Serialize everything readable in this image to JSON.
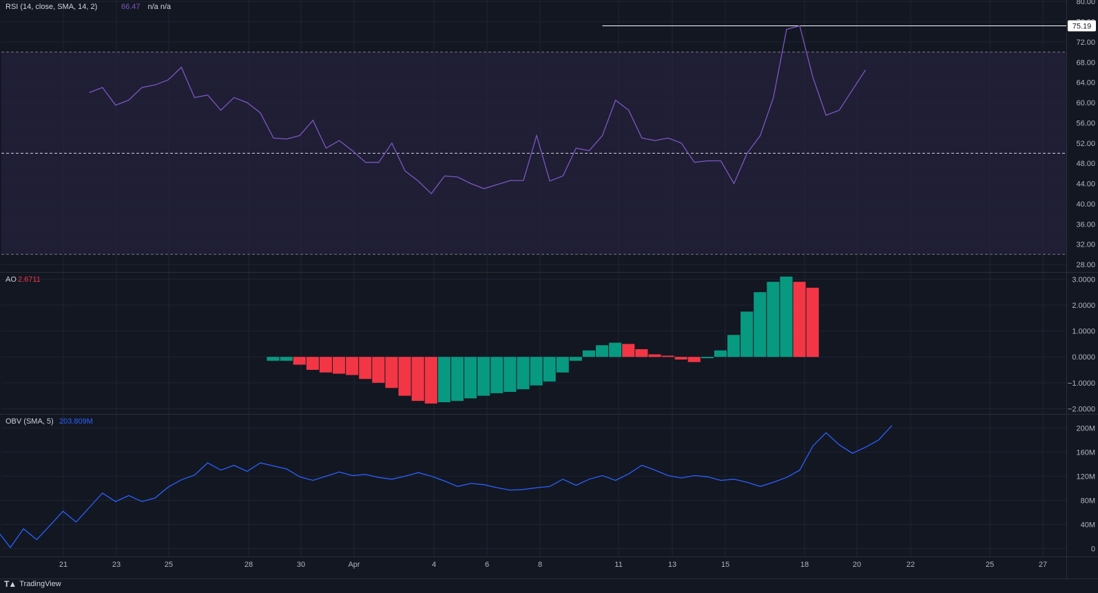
{
  "branding": {
    "logo_icon": "tradingview-logo-icon",
    "name": "TradingView"
  },
  "colors": {
    "background": "#131722",
    "grid": "#1f2433",
    "axis_text": "#b2b5be",
    "rsi_line": "#7e57c2",
    "rsi_band": "#2a2445",
    "rsi_value": "#7e57c2",
    "ao_up": "#089981",
    "ao_down": "#f23645",
    "obv_line": "#2962ff",
    "obv_value": "#2962ff",
    "marker_line": "#ffffff"
  },
  "x_axis": {
    "labels": [
      "21",
      "23",
      "25",
      "28",
      "30",
      "Apr",
      "4",
      "6",
      "8",
      "11",
      "13",
      "15",
      "18",
      "20",
      "22",
      "25",
      "27"
    ]
  },
  "chart_data": [
    {
      "type": "line",
      "legend": "RSI (14, close, SMA, 14, 2)",
      "value_text": "66.47",
      "extra_text": "n/a  n/a",
      "y_ticks": [
        "80.00",
        "76.00",
        "72.00",
        "68.00",
        "64.00",
        "60.00",
        "56.00",
        "52.00",
        "48.00",
        "44.00",
        "40.00",
        "36.00",
        "32.00",
        "28.00"
      ],
      "ylim": [
        26.5,
        80.3
      ],
      "levels": [
        70,
        50,
        30
      ],
      "band": [
        30,
        70
      ],
      "highlight_value": "75.19",
      "highlight_level": 75.19,
      "highlight_start_bar": 45,
      "start_bar": 6,
      "values": [
        62,
        63,
        59.5,
        60.5,
        63,
        63.5,
        64.5,
        67,
        61,
        61.5,
        58.5,
        61,
        60,
        58,
        53,
        52.8,
        53.5,
        56.5,
        51,
        52.5,
        50.5,
        48.2,
        48.2,
        52,
        46.5,
        44.5,
        42,
        45.5,
        45.3,
        44,
        43,
        43.8,
        44.6,
        44.6,
        53.5,
        44.5,
        45.5,
        51,
        50.5,
        53.5,
        60.5,
        58.5,
        53,
        52.5,
        53,
        52,
        48.2,
        48.5,
        48.5,
        44,
        50,
        53.5,
        61,
        74.5,
        75.19,
        65,
        57.5,
        58.5,
        62.5,
        66.47
      ]
    },
    {
      "type": "bar",
      "legend": "AO",
      "value_text": "2.6711",
      "y_ticks": [
        "3.0000",
        "2.0000",
        "1.0000",
        "0.0000",
        "−1.0000",
        "−2.0000"
      ],
      "ylim": [
        -2.2,
        3.25
      ],
      "start_bar": 20,
      "values": [
        -0.15,
        -0.15,
        -0.3,
        -0.5,
        -0.6,
        -0.65,
        -0.7,
        -0.85,
        -1.0,
        -1.2,
        -1.5,
        -1.7,
        -1.8,
        -1.75,
        -1.7,
        -1.6,
        -1.5,
        -1.4,
        -1.35,
        -1.25,
        -1.1,
        -0.95,
        -0.6,
        -0.15,
        0.25,
        0.45,
        0.55,
        0.5,
        0.3,
        0.1,
        0.05,
        -0.1,
        -0.2,
        -0.05,
        0.25,
        0.85,
        1.75,
        2.5,
        2.9,
        3.1,
        2.9,
        2.6711
      ],
      "colors": [
        "up",
        "up",
        "down",
        "down",
        "down",
        "down",
        "down",
        "down",
        "down",
        "down",
        "down",
        "down",
        "down",
        "up",
        "up",
        "up",
        "up",
        "up",
        "up",
        "up",
        "up",
        "up",
        "up",
        "up",
        "up",
        "up",
        "up",
        "down",
        "down",
        "down",
        "down",
        "down",
        "down",
        "up",
        "up",
        "up",
        "up",
        "up",
        "up",
        "up",
        "down",
        "down"
      ]
    },
    {
      "type": "line",
      "legend": "OBV (SMA, 5)",
      "value_text": "203.809M",
      "y_ticks": [
        "200M",
        "160M",
        "120M",
        "80M",
        "40M",
        "0"
      ],
      "ylim": [
        -13,
        222
      ],
      "start_bar": -4,
      "values": [
        56,
        75,
        52,
        30,
        2,
        33,
        15,
        38,
        62,
        44,
        68,
        92,
        78,
        88,
        78,
        84,
        102,
        114,
        122,
        142,
        130,
        138,
        128,
        142,
        137,
        132,
        119,
        113,
        120,
        127,
        121,
        123,
        118,
        115,
        120,
        126,
        120,
        112,
        103,
        108,
        106,
        101,
        97,
        98,
        101,
        103,
        115,
        105,
        115,
        121,
        113,
        124,
        138,
        130,
        121,
        117,
        121,
        119,
        113,
        115,
        110,
        103,
        110,
        118,
        130,
        170,
        192,
        172,
        158,
        168,
        180,
        203.809
      ]
    }
  ]
}
